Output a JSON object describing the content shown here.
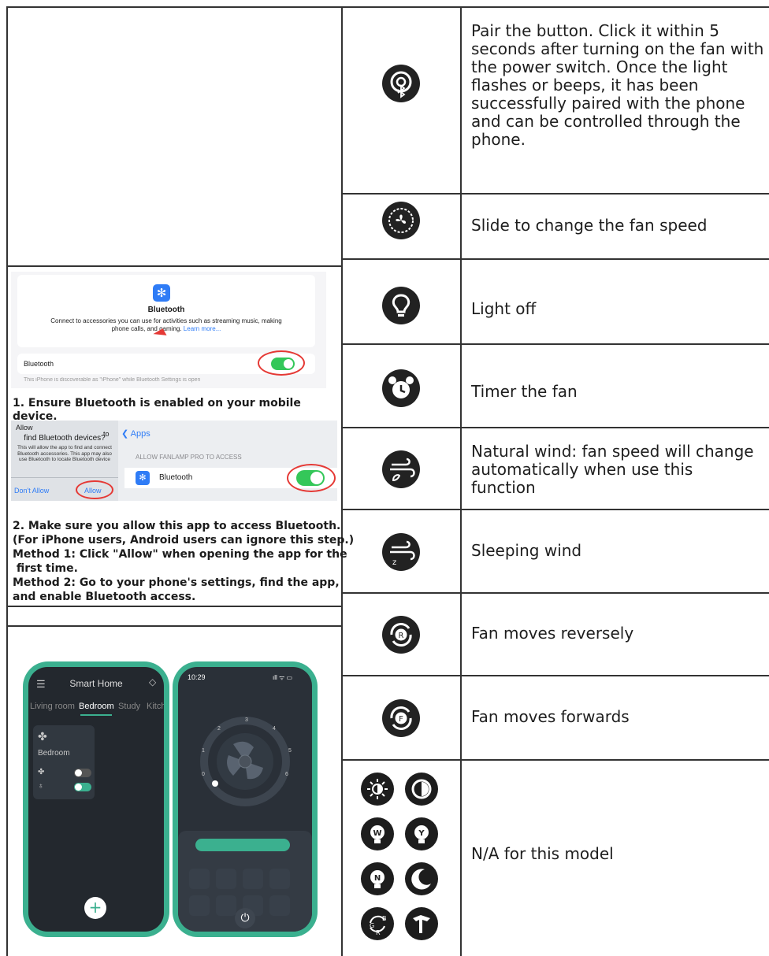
{
  "left": {
    "bt_settings": {
      "title": "Bluetooth",
      "desc": "Connect to accessories you can use for activities such as streaming music, making phone calls, and gaming.",
      "learn_more": "Learn more...",
      "row_label": "Bluetooth",
      "footnote": "This iPhone is discoverable as \"iPhone\" while Bluetooth Settings is open"
    },
    "step1": "1. Ensure Bluetooth is enabled on your mobile device.",
    "dialog": {
      "allow_prefix": "Allow",
      "to": "to",
      "question": "find Bluetooth devices?",
      "body": "This will allow the app to find and connect Bluetooth accessories. This app may also use Bluetooth to locate Bluetooth device",
      "dont_allow": "Don't Allow",
      "allow": "Allow"
    },
    "app_settings": {
      "back": "Apps",
      "section": "ALLOW FANLAMP PRO TO ACCESS",
      "row": "Bluetooth"
    },
    "step2": [
      "2. Make sure you allow this app to access Bluetooth.",
      "(For iPhone users, Android users can ignore this step.)",
      "Method 1: Click \"Allow\" when opening the app for the",
      " first time.",
      "Method 2: Go to your phone's settings, find the app,",
      "and enable Bluetooth access."
    ],
    "phone1": {
      "title": "Smart Home",
      "tabs": [
        "Living room",
        "Bedroom",
        "Study",
        "Kitch"
      ],
      "card_label": "Bedroom"
    },
    "phone2": {
      "time": "10:29",
      "dial_numbers": [
        "1",
        "2",
        "3",
        "4",
        "5",
        "6",
        "0"
      ]
    }
  },
  "right": {
    "rows": [
      {
        "icon": "bluetooth-pair-icon",
        "text": "Pair the button. Click it within 5 seconds after turning on the fan with the power switch. Once the light flashes or beeps, it has been successfully paired with the phone and can be controlled through the phone."
      },
      {
        "icon": "fan-speed-icon",
        "text": "Slide to change the fan speed"
      },
      {
        "icon": "light-bulb-icon",
        "text": "Light off"
      },
      {
        "icon": "alarm-clock-icon",
        "text": "Timer the fan"
      },
      {
        "icon": "natural-wind-icon",
        "text": "Natural wind: fan speed will change automatically when use this function"
      },
      {
        "icon": "sleeping-wind-icon",
        "text": "Sleeping wind"
      },
      {
        "icon": "reverse-r-icon",
        "text": "Fan moves reversely"
      },
      {
        "icon": "forward-f-icon",
        "text": "Fan moves forwards"
      },
      {
        "icon": "na-icons-group",
        "text": "N/A for this model"
      }
    ],
    "na_icons": [
      {
        "name": "brightness-icon",
        "label": ""
      },
      {
        "name": "contrast-icon",
        "label": ""
      },
      {
        "name": "warm-white-bulb-icon",
        "label": "W"
      },
      {
        "name": "yellow-bulb-icon",
        "label": "Y"
      },
      {
        "name": "neutral-bulb-icon",
        "label": "N"
      },
      {
        "name": "moon-icon",
        "label": ""
      },
      {
        "name": "rgb-cycle-icon",
        "label": "G B R"
      },
      {
        "name": "hammer-icon",
        "label": ""
      }
    ]
  }
}
